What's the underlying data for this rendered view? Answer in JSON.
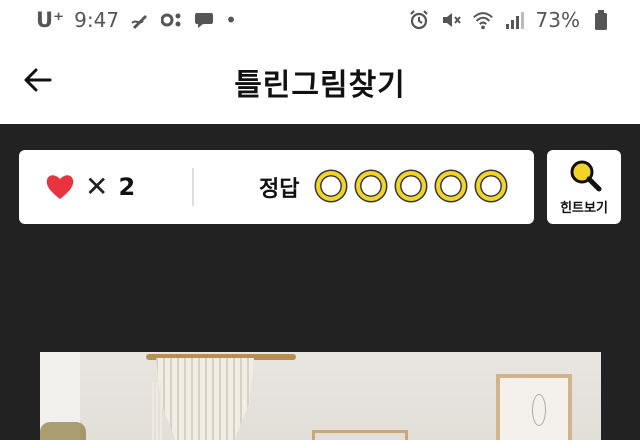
{
  "status_bar": {
    "carrier": "U⁺",
    "time": "9:47",
    "dot": "•",
    "battery": "73%"
  },
  "header": {
    "title": "틀린그림찾기"
  },
  "game": {
    "lives_symbol": "✕",
    "lives_count": "2",
    "answer_label": "정답",
    "answers_found": 0,
    "answers_total": 5,
    "hint_label": "힌트보기"
  },
  "colors": {
    "heart": "#e8343f",
    "slot_ring": "#f2d32a",
    "background": "#222222",
    "panel": "#ffffff"
  }
}
